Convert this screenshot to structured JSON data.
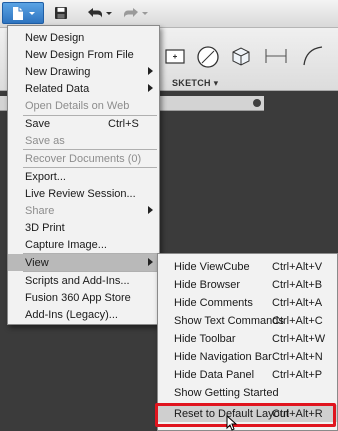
{
  "file_menu": {
    "items": [
      {
        "label": "New Design",
        "shortcut": "",
        "has_submenu": false,
        "disabled": false
      },
      {
        "label": "New Design From File",
        "shortcut": "",
        "has_submenu": false,
        "disabled": false
      },
      {
        "label": "New Drawing",
        "shortcut": "",
        "has_submenu": true,
        "disabled": false
      },
      {
        "label": "Related Data",
        "shortcut": "",
        "has_submenu": true,
        "disabled": false
      },
      {
        "label": "Open Details on Web",
        "shortcut": "",
        "has_submenu": false,
        "disabled": true
      },
      {
        "label": "Save",
        "shortcut": "Ctrl+S",
        "has_submenu": false,
        "disabled": false
      },
      {
        "label": "Save as",
        "shortcut": "",
        "has_submenu": false,
        "disabled": true
      },
      {
        "label": "Recover Documents (0)",
        "shortcut": "",
        "has_submenu": false,
        "disabled": true
      },
      {
        "label": "Export...",
        "shortcut": "",
        "has_submenu": false,
        "disabled": false
      },
      {
        "label": "Live Review Session...",
        "shortcut": "",
        "has_submenu": false,
        "disabled": false
      },
      {
        "label": "Share",
        "shortcut": "",
        "has_submenu": true,
        "disabled": true
      },
      {
        "label": "3D Print",
        "shortcut": "",
        "has_submenu": false,
        "disabled": false
      },
      {
        "label": "Capture Image...",
        "shortcut": "",
        "has_submenu": false,
        "disabled": false
      },
      {
        "label": "View",
        "shortcut": "",
        "has_submenu": true,
        "disabled": false
      },
      {
        "label": "Scripts and Add-Ins...",
        "shortcut": "",
        "has_submenu": false,
        "disabled": false
      },
      {
        "label": "Fusion 360 App Store",
        "shortcut": "",
        "has_submenu": false,
        "disabled": false
      },
      {
        "label": "Add-Ins (Legacy)...",
        "shortcut": "",
        "has_submenu": false,
        "disabled": false
      }
    ]
  },
  "view_menu": {
    "items": [
      {
        "label": "Hide ViewCube",
        "shortcut": "Ctrl+Alt+V"
      },
      {
        "label": "Hide Browser",
        "shortcut": "Ctrl+Alt+B"
      },
      {
        "label": "Hide Comments",
        "shortcut": "Ctrl+Alt+A"
      },
      {
        "label": "Show Text Commands",
        "shortcut": "Ctrl+Alt+C"
      },
      {
        "label": "Hide Toolbar",
        "shortcut": "Ctrl+Alt+W"
      },
      {
        "label": "Hide Navigation Bar",
        "shortcut": "Ctrl+Alt+N"
      },
      {
        "label": "Hide Data Panel",
        "shortcut": "Ctrl+Alt+P"
      },
      {
        "label": "Show Getting Started",
        "shortcut": ""
      },
      {
        "label": "Reset to Default Layout",
        "shortcut": "Ctrl+Alt+R"
      }
    ]
  },
  "ribbon": {
    "sketch_label": "SKETCH ▾"
  },
  "colors": {
    "file_button": "#3a82cf",
    "highlight": "#e0141e",
    "menu_bg": "#f2f2f2"
  },
  "icons": [
    "file-icon",
    "save-icon",
    "undo-icon",
    "redo-icon",
    "dropdown-arrow-icon"
  ]
}
